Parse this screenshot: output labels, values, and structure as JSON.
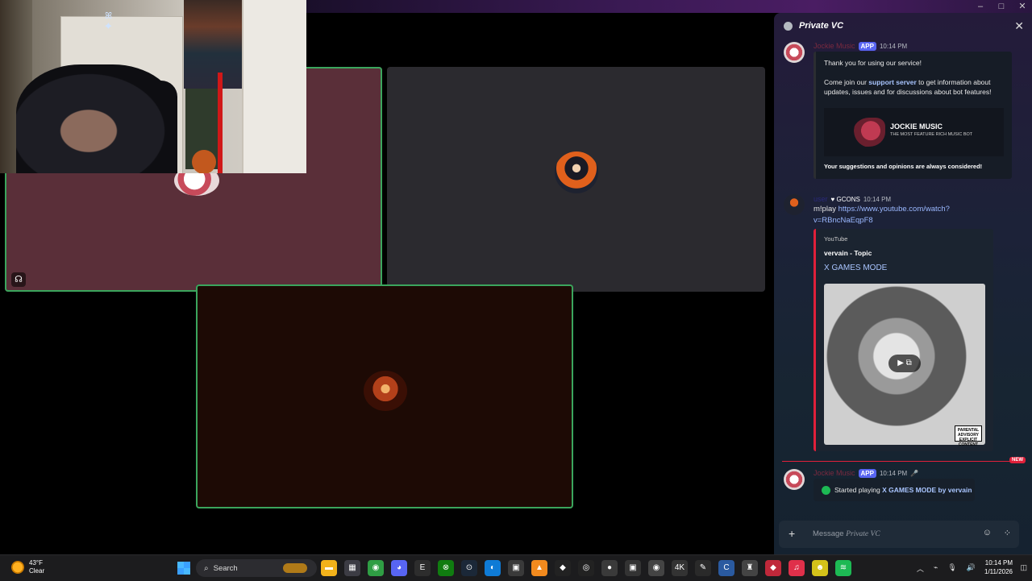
{
  "window": {
    "minimize": "–",
    "maximize": "□",
    "close": "✕"
  },
  "webcam": {
    "sparkle": "ꕤ ✦"
  },
  "stage": {
    "tile_icon": "☊"
  },
  "chat": {
    "title": "Private VC",
    "close": "✕",
    "messages": [
      {
        "author": "Jockie Music",
        "badge": "APP",
        "time": "10:14 PM",
        "line1": "Thank you for using our service!",
        "line2_pre": "Come join our ",
        "line2_link": "support server",
        "line2_post": " to get information about updates, issues and for discussions about bot features!",
        "banner_title": "JOCKIE MUSIC",
        "banner_sub": "THE MOST FEATURE RICH MUSIC BOT",
        "footer": "Your suggestions and opinions are always considered!"
      },
      {
        "author": "user",
        "tag": "♥ GCONS",
        "time": "10:14 PM",
        "cmd": "m!play ",
        "url": "https://www.youtube.com/watch?v=RBncNaEqpF8",
        "embed_provider": "YouTube",
        "embed_author": "vervain - Topic",
        "embed_title": "X GAMES MODE",
        "play": "▶ ⧉",
        "advisory": "PARENTAL ADVISORY EXPLICIT CONTENT"
      },
      {
        "author": "Jockie Music",
        "badge": "APP",
        "time": "10:14 PM",
        "extra": "🎤",
        "pre": "Started playing ",
        "song": "X GAMES MODE by vervain"
      }
    ],
    "new_badge": "NEW",
    "composer": {
      "plus": "+",
      "placeholder": "Message ",
      "placeholder_channel": "Private VC",
      "emoji": "☺",
      "apps": "⁘"
    }
  },
  "taskbar": {
    "temp": "43°F",
    "condition": "Clear",
    "search": "Search",
    "search_icon": "⌕",
    "apps": [
      {
        "name": "file-explorer",
        "glyph": "▬",
        "color": "#f2b21b"
      },
      {
        "name": "store",
        "glyph": "▦",
        "color": "#3c3c44"
      },
      {
        "name": "chrome",
        "glyph": "◉",
        "color": "#2f9e44"
      },
      {
        "name": "discord",
        "glyph": "◕",
        "color": "#5865f2"
      },
      {
        "name": "epic",
        "glyph": "E",
        "color": "#2d2d2d"
      },
      {
        "name": "xbox",
        "glyph": "⊗",
        "color": "#107c10"
      },
      {
        "name": "steam",
        "glyph": "⊙",
        "color": "#1b2838"
      },
      {
        "name": "edge",
        "glyph": "◐",
        "color": "#0f7bd6"
      },
      {
        "name": "minecraft",
        "glyph": "▣",
        "color": "#3a3a3a"
      },
      {
        "name": "vlc",
        "glyph": "▲",
        "color": "#f28a1e"
      },
      {
        "name": "capcut",
        "glyph": "◆",
        "color": "#222"
      },
      {
        "name": "obs",
        "glyph": "◎",
        "color": "#222"
      },
      {
        "name": "rec",
        "glyph": "●",
        "color": "#3a3a3a"
      },
      {
        "name": "app-b",
        "glyph": "▣",
        "color": "#333"
      },
      {
        "name": "app-c",
        "glyph": "◉",
        "color": "#444"
      },
      {
        "name": "4k",
        "glyph": "4K",
        "color": "#333"
      },
      {
        "name": "app-d",
        "glyph": "✎",
        "color": "#2a2a2a"
      },
      {
        "name": "ccleaner",
        "glyph": "C",
        "color": "#2a5aa0"
      },
      {
        "name": "app-e",
        "glyph": "♜",
        "color": "#444"
      },
      {
        "name": "app-f",
        "glyph": "◆",
        "color": "#c0283a"
      },
      {
        "name": "music",
        "glyph": "♫",
        "color": "#e0304a"
      },
      {
        "name": "app-g",
        "glyph": "☻",
        "color": "#d4c21a"
      },
      {
        "name": "spotify",
        "glyph": "≋",
        "color": "#1db954"
      }
    ],
    "tray": [
      "︿",
      "⌁",
      "🎙",
      "🔊"
    ],
    "time": "10:14 PM",
    "date": "1/11/2026",
    "notif": "◫"
  }
}
